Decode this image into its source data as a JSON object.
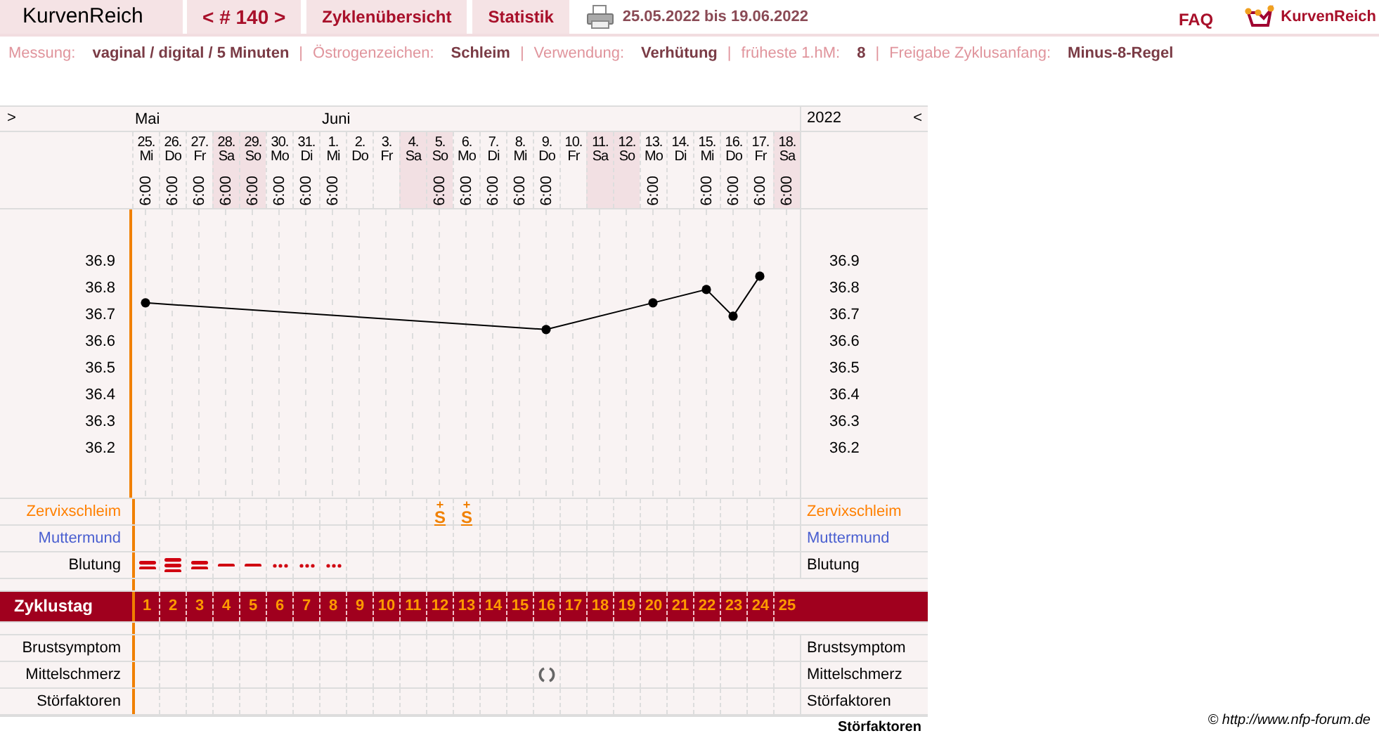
{
  "nav": {
    "brand": "KurvenReich",
    "cycle": "< # 140 >",
    "tabs": [
      {
        "label": "Zyklenübersicht"
      },
      {
        "label": "Statistik"
      }
    ],
    "date_range": "25.05.2022 bis 19.06.2022",
    "faq": "FAQ",
    "logo_text": "KurvenReich"
  },
  "info": [
    {
      "label": "Messung:",
      "value": "vaginal / digital / 5 Minuten"
    },
    {
      "sep": "|",
      "label": "Östrogenzeichen:",
      "value": "Schleim"
    },
    {
      "sep": "|",
      "label": "Verwendung:",
      "value": "Verhütung"
    },
    {
      "sep": "|",
      "label": "früheste 1.hM:",
      "value": "8"
    },
    {
      "sep": "|",
      "label": "Freigabe Zyklusanfang:",
      "value": "Minus-8-Regel"
    }
  ],
  "table": {
    "expand_left": ">",
    "year": "2022",
    "expand_right": "<",
    "days": [
      {
        "month": "Mai",
        "weekday": "Mi",
        "time": "6:00",
        "weekend": false,
        "bleeding": {
          "kind": "strong"
        },
        "mittelschmerz": false
      },
      {
        "weekday": "Do",
        "time": "6:00",
        "weekend": false,
        "bleeding": {
          "kind": "heavy"
        },
        "mittelschmerz": false
      },
      {
        "weekday": "Fr",
        "time": "6:00",
        "weekend": false,
        "bleeding": {
          "kind": "strong"
        },
        "mittelschmerz": false
      },
      {
        "weekday": "Sa",
        "time": "6:00",
        "weekend": true,
        "bleeding": {
          "kind": "normal"
        },
        "mittelschmerz": false
      },
      {
        "weekday": "So",
        "time": "6:00",
        "weekend": true,
        "bleeding": {
          "kind": "normal"
        },
        "mittelschmerz": false
      },
      {
        "weekday": "Mo",
        "time": "6:00",
        "weekend": false,
        "bleeding": {
          "kind": "spotting"
        },
        "mittelschmerz": false
      },
      {
        "weekday": "Di",
        "time": "6:00",
        "weekend": false,
        "bleeding": {
          "kind": "spotting"
        },
        "mittelschmerz": false
      },
      {
        "month": "Juni",
        "weekday": "Mi",
        "time": "6:00",
        "weekend": false,
        "bleeding": {
          "kind": "spotting"
        },
        "mittelschmerz": false
      },
      {
        "weekday": "Do",
        "weekend": false,
        "mittelschmerz": false
      },
      {
        "weekday": "Fr",
        "weekend": false,
        "mittelschmerz": false
      },
      {
        "weekday": "Sa",
        "weekend": true,
        "mittelschmerz": false
      },
      {
        "weekday": "So",
        "time": "6:00",
        "weekend": true,
        "mucus": "S",
        "mucus_mark": "+",
        "mittelschmerz": false
      },
      {
        "weekday": "Mo",
        "time": "6:00",
        "weekend": false,
        "mucus": "S",
        "mucus_mark": "+",
        "mittelschmerz": false
      },
      {
        "weekday": "Di",
        "time": "6:00",
        "weekend": false,
        "mittelschmerz": false
      },
      {
        "weekday": "Mi",
        "time": "6:00",
        "weekend": false,
        "mittelschmerz": false
      },
      {
        "weekday": "Do",
        "time": "6:00",
        "weekend": false,
        "mittelschmerz": true
      },
      {
        "weekday": "Fr",
        "weekend": false,
        "mittelschmerz": false
      },
      {
        "weekday": "Sa",
        "weekend": true,
        "mittelschmerz": false
      },
      {
        "weekday": "So",
        "weekend": true,
        "mittelschmerz": false
      },
      {
        "weekday": "Mo",
        "time": "6:00",
        "weekend": false,
        "mittelschmerz": false
      },
      {
        "weekday": "Di",
        "weekend": false,
        "mittelschmerz": false
      },
      {
        "weekday": "Mi",
        "time": "6:00",
        "weekend": false,
        "mittelschmerz": false
      },
      {
        "weekday": "Do",
        "time": "6:00",
        "weekend": false,
        "mittelschmerz": false
      },
      {
        "weekday": "Fr",
        "time": "6:00",
        "weekend": false,
        "mittelschmerz": false
      },
      {
        "weekday": "Sa",
        "time": "6:00",
        "weekend": true,
        "mittelschmerz": false
      }
    ],
    "chart_data": {
      "type": "line",
      "categories": [
        "25.",
        "26.",
        "27.",
        "28.",
        "29.",
        "30.",
        "31.",
        "1.",
        "2.",
        "3.",
        "4.",
        "5.",
        "6.",
        "7.",
        "8.",
        "9.",
        "10.",
        "11.",
        "12.",
        "13.",
        "14.",
        "15.",
        "16.",
        "17.",
        "18."
      ],
      "ylim": [
        36.02,
        37.1
      ],
      "yticks": [
        36.2,
        36.3,
        36.4,
        36.5,
        36.6,
        36.7,
        36.8,
        36.9
      ],
      "grid": true,
      "series": [
        {
          "color": "#000000",
          "marker": "circle",
          "values": [
            36.75,
            null,
            null,
            null,
            null,
            null,
            null,
            null,
            null,
            null,
            null,
            null,
            null,
            null,
            null,
            36.65,
            null,
            null,
            null,
            36.75,
            null,
            36.8,
            36.7,
            36.85,
            null
          ]
        }
      ]
    },
    "right_scale": [
      "36.9",
      "36.8",
      "36.7",
      "36.6",
      "36.5",
      "36.4",
      "36.3",
      "36.2"
    ],
    "rows_top": [
      {
        "label": "Zervixschleim",
        "label_right": "Zervixschleim",
        "kind": "mucus",
        "color": "#ff8000"
      },
      {
        "label": "Muttermund",
        "label_right": "Muttermund",
        "kind": "cervix",
        "color": "#4a5fd0"
      },
      {
        "label": "Blutung",
        "label_right": "Blutung",
        "kind": "bleeding",
        "color": "#000000"
      }
    ],
    "cycle_day_label": "Zyklustag",
    "cycle_days": [
      "1",
      "2",
      "3",
      "4",
      "5",
      "6",
      "7",
      "8",
      "9",
      "10",
      "11",
      "12",
      "13",
      "14",
      "15",
      "16",
      "17",
      "18",
      "19",
      "20",
      "21",
      "22",
      "23",
      "24",
      "25"
    ],
    "rows_bottom": [
      {
        "label": "Brustsymptom",
        "label_right": "Brustsymptom",
        "kind": "breast"
      },
      {
        "label": "Mittelschmerz",
        "label_right": "Mittelschmerz",
        "kind": "pain"
      },
      {
        "label": "Störfaktoren",
        "label_right": "Störfaktoren",
        "kind": "disturb"
      }
    ]
  },
  "footer": {
    "heading": "Störfaktoren",
    "copyright": "© http://www.nfp-forum.de"
  }
}
